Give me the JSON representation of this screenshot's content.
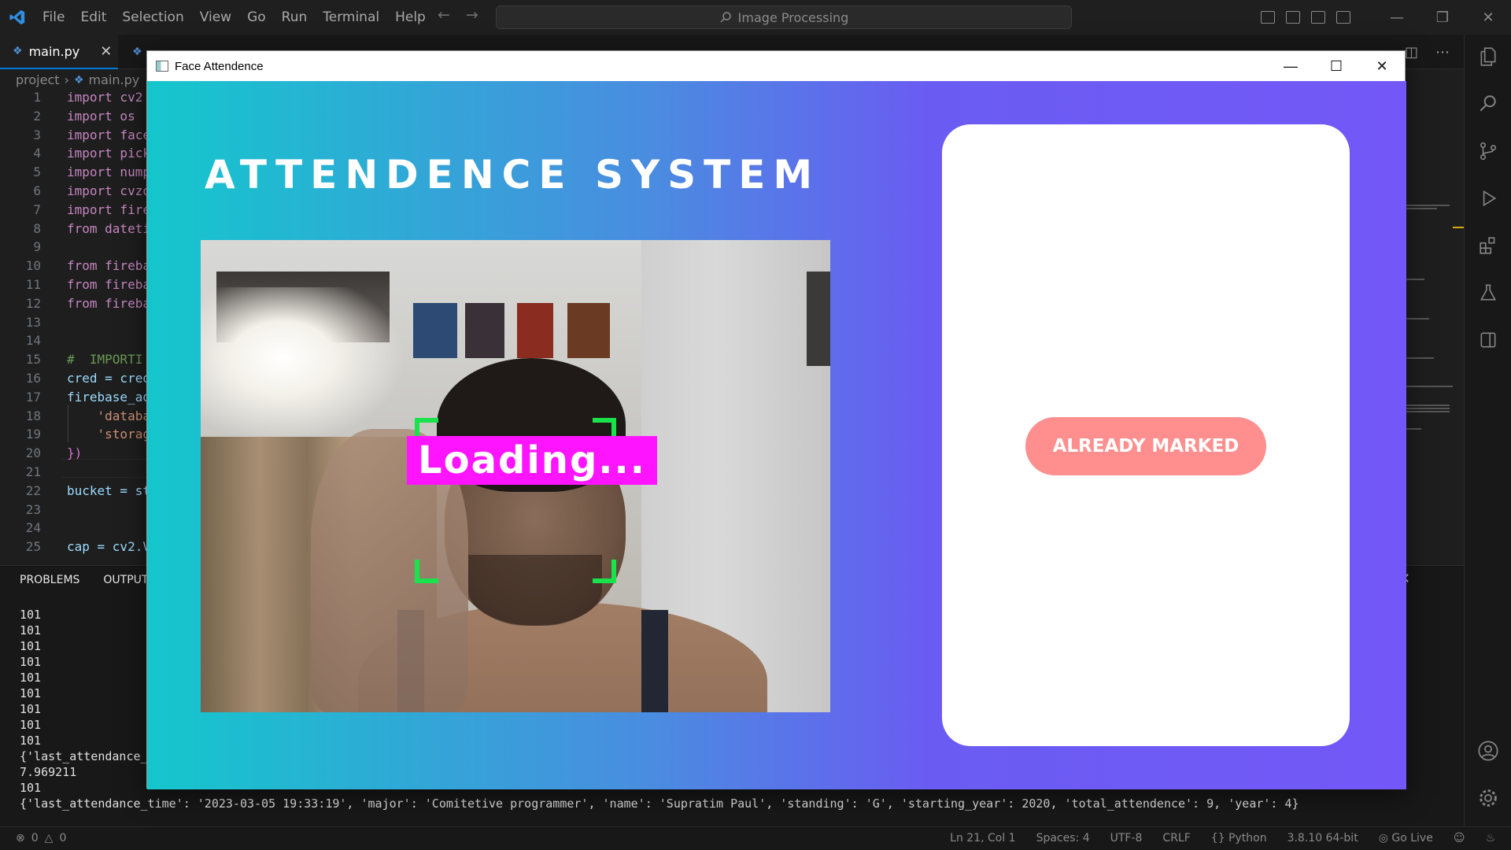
{
  "vscode": {
    "menu": [
      "File",
      "Edit",
      "Selection",
      "View",
      "Go",
      "Run",
      "Terminal",
      "Help"
    ],
    "search_label": "Image Processing",
    "active_tab": "main.py",
    "breadcrumb": {
      "folder": "project",
      "file": "main.py"
    },
    "editor_lines": [
      {
        "n": "1",
        "code": "import cv2"
      },
      {
        "n": "2",
        "code": "import os"
      },
      {
        "n": "3",
        "code": "import face"
      },
      {
        "n": "4",
        "code": "import pick"
      },
      {
        "n": "5",
        "code": "import nump"
      },
      {
        "n": "6",
        "code": "import cvzo"
      },
      {
        "n": "7",
        "code": "import fire"
      },
      {
        "n": "8",
        "code": "from dateti"
      },
      {
        "n": "9",
        "code": ""
      },
      {
        "n": "10",
        "code": "from fireba"
      },
      {
        "n": "11",
        "code": "from fireba"
      },
      {
        "n": "12",
        "code": "from fireba"
      },
      {
        "n": "13",
        "code": ""
      },
      {
        "n": "14",
        "code": ""
      },
      {
        "n": "15",
        "code": "#  IMPORTI"
      },
      {
        "n": "16",
        "code": "cred = cred"
      },
      {
        "n": "17",
        "code": "firebase_ad"
      },
      {
        "n": "18",
        "code": "    'databa"
      },
      {
        "n": "19",
        "code": "    'storag"
      },
      {
        "n": "20",
        "code": "})"
      },
      {
        "n": "21",
        "code": ""
      },
      {
        "n": "22",
        "code": "bucket = st"
      },
      {
        "n": "23",
        "code": ""
      },
      {
        "n": "24",
        "code": ""
      },
      {
        "n": "25",
        "code": "cap = cv2.V"
      }
    ],
    "panel_tabs": [
      "PROBLEMS",
      "OUTPUT"
    ],
    "terminal_lines": [
      "101",
      "101",
      "101",
      "101",
      "101",
      "101",
      "101",
      "101",
      "101",
      "{'last_attendance_",
      "7.969211",
      "101",
      "{'last_attendance_time': '2023-03-05 19:33:19', 'major': 'Comitetive programmer', 'name': 'Supratim Paul', 'standing': 'G', 'starting_year': 2020, 'total_attendence': 9, 'year': 4}"
    ],
    "status": {
      "errors": "0",
      "warnings": "0",
      "position": "Ln 21, Col 1",
      "spaces": "Spaces: 4",
      "encoding": "UTF-8",
      "eol": "CRLF",
      "language": "Python",
      "interpreter": "3.8.10 64-bit",
      "live": "Go Live"
    }
  },
  "face_app": {
    "window_title": "Face Attendence",
    "heading": "ATTENDENCE SYSTEM",
    "overlay_text": "Loading...",
    "status_button": "ALREADY MARKED",
    "colors": {
      "gradient_start": "#14c7cc",
      "gradient_end": "#7358f7",
      "loading_bg": "#ff14ff",
      "face_box": "#19e34a",
      "button_bg": "#ff8f8f"
    }
  }
}
